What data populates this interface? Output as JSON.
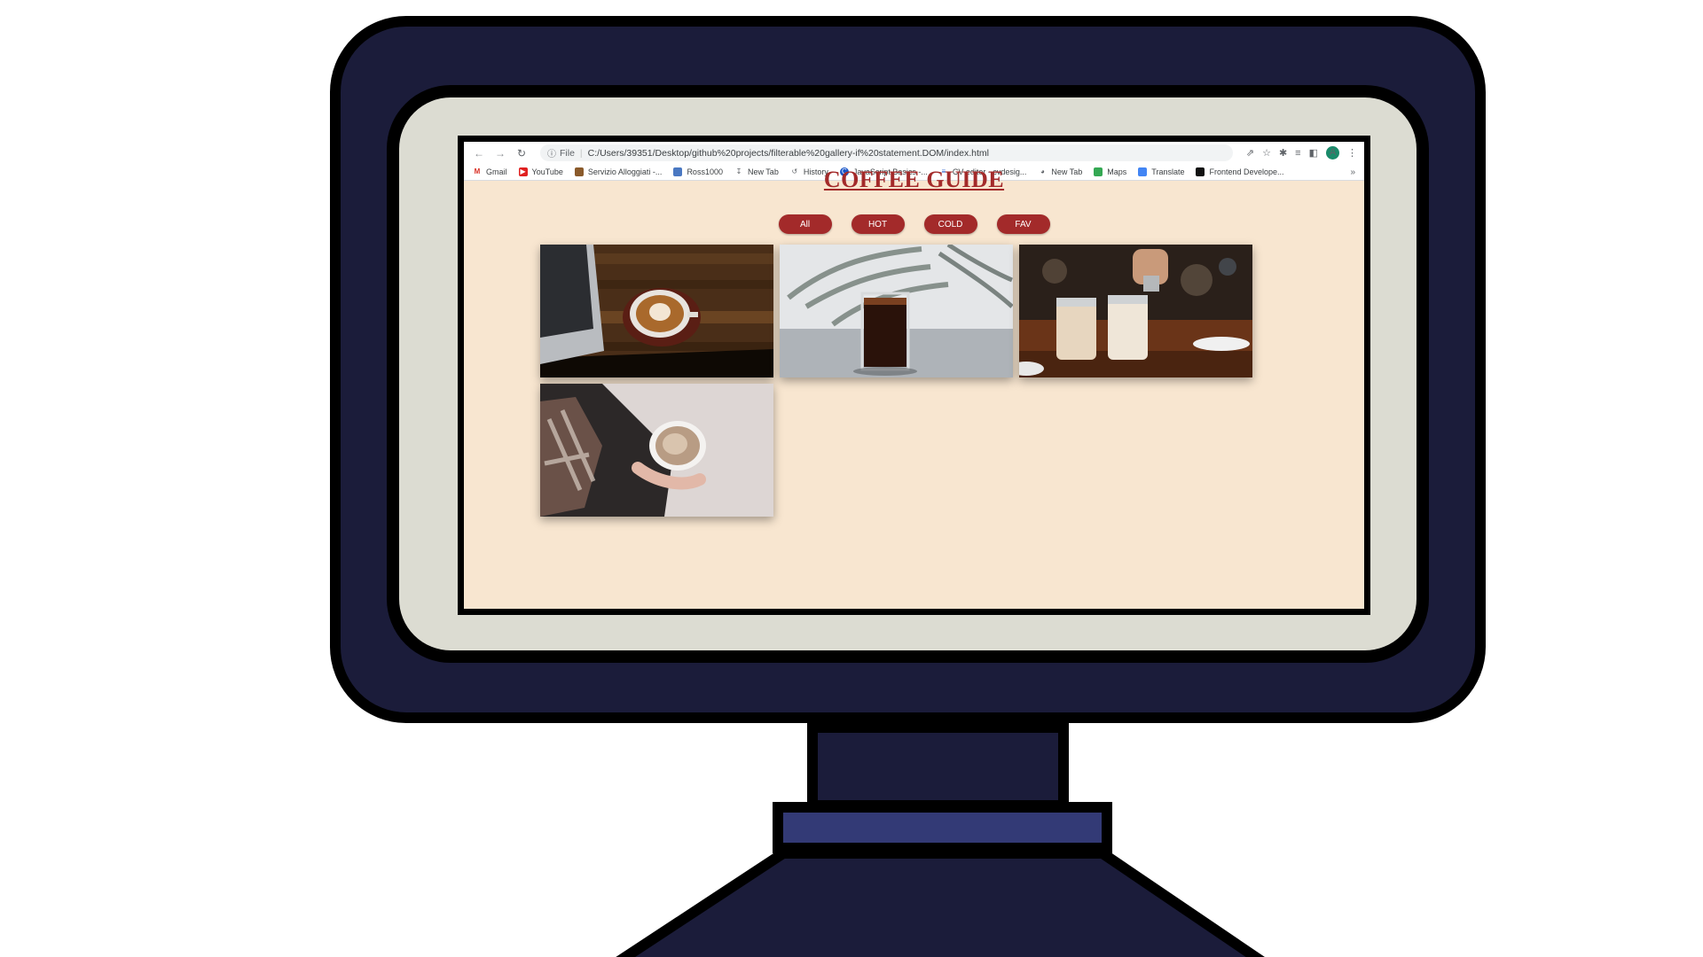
{
  "browser": {
    "url_scheme": "File",
    "url": "C:/Users/39351/Desktop/github%20projects/filterable%20gallery-if%20statement.DOM/index.html",
    "profile_initial": "A",
    "bookmarks": [
      {
        "label": "Gmail",
        "icon": "gmail-icon"
      },
      {
        "label": "YouTube",
        "icon": "youtube-icon"
      },
      {
        "label": "Servizio Alloggiati -...",
        "icon": "servizio-icon"
      },
      {
        "label": "Ross1000",
        "icon": "ross-icon"
      },
      {
        "label": "New Tab",
        "icon": "download-icon"
      },
      {
        "label": "History",
        "icon": "history-icon"
      },
      {
        "label": "JavaScript Basics -...",
        "icon": "javascript-icon"
      },
      {
        "label": "CV editor - cvdesig...",
        "icon": "cv-icon"
      },
      {
        "label": "New Tab",
        "icon": "globe-icon"
      },
      {
        "label": "Maps",
        "icon": "maps-icon"
      },
      {
        "label": "Translate",
        "icon": "translate-icon"
      },
      {
        "label": "Frontend Develope...",
        "icon": "frontend-icon"
      }
    ],
    "more_bookmarks": "»"
  },
  "page": {
    "title": "COFFEE GUIDE",
    "filters": [
      "All",
      "HOT",
      "COLD",
      "FAV"
    ]
  }
}
